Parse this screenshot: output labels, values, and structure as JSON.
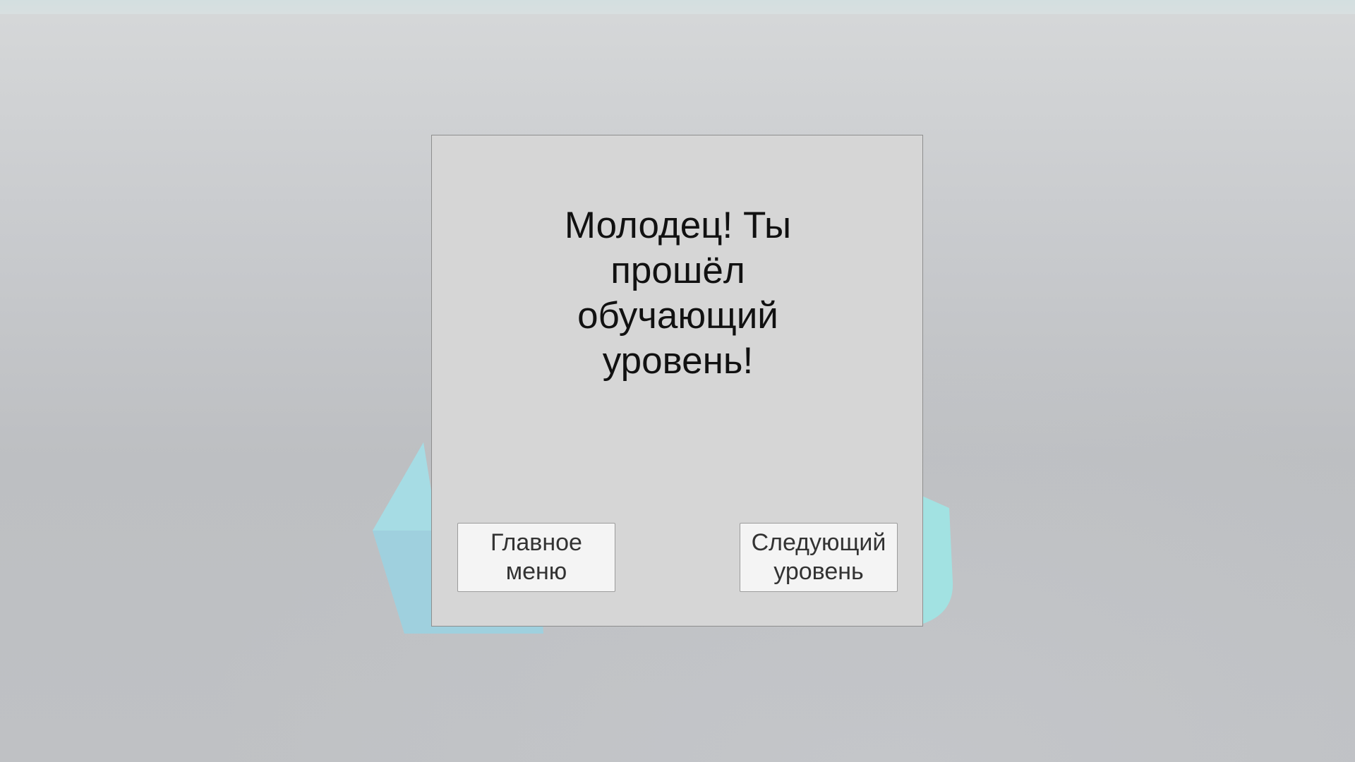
{
  "dialog": {
    "message": "Молодец! Ты прошёл обучающий уровень!"
  },
  "buttons": {
    "main_menu_label": "Главное меню",
    "next_level_label": "Следующий уровень"
  },
  "colors": {
    "panel": "#d6d6d6",
    "button": "#f4f4f4",
    "text": "#111111",
    "scene_object": "#9fdbe2"
  }
}
